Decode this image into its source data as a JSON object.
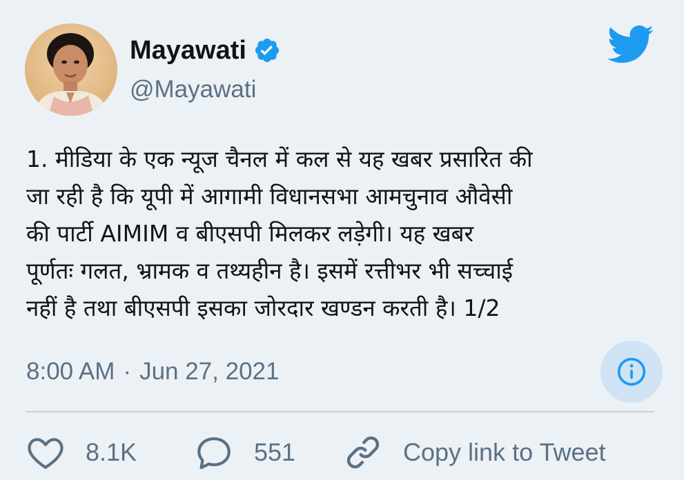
{
  "author": {
    "name": "Mayawati",
    "handle": "@Mayawati",
    "verified_icon": "verified-badge-icon",
    "avatar_icon": "profile-photo"
  },
  "brand": {
    "icon": "twitter-bird-icon",
    "color": "#1d9bf0"
  },
  "tweet": {
    "text": "1. मीडिया के एक न्यूज चैनल में कल से यह खबर प्रसारित की\nजा रही है कि यूपी में आगामी विधानसभा आमचुनाव औवेसी\nकी पार्टी AIMIM  व  बीएसपी मिलकर लड़ेगी। यह खबर\nपूर्णतः गलत, भ्रामक व तथ्यहीन है। इसमें रत्तीभर भी सच्चाई\nनहीं है तथा बीएसपी इसका जोरदार खण्डन करती है। 1/2",
    "time": "8:00 AM",
    "separator": "·",
    "date": "Jun 27, 2021"
  },
  "actions": {
    "like_count": "8.1K",
    "reply_count": "551",
    "copy_label": "Copy link to Tweet",
    "info_icon": "info-icon"
  },
  "colors": {
    "background": "#ecf1f5",
    "text_primary": "#0f1419",
    "text_secondary": "#5b7083",
    "accent": "#1d9bf0",
    "info_bg": "#cfe3f5"
  }
}
